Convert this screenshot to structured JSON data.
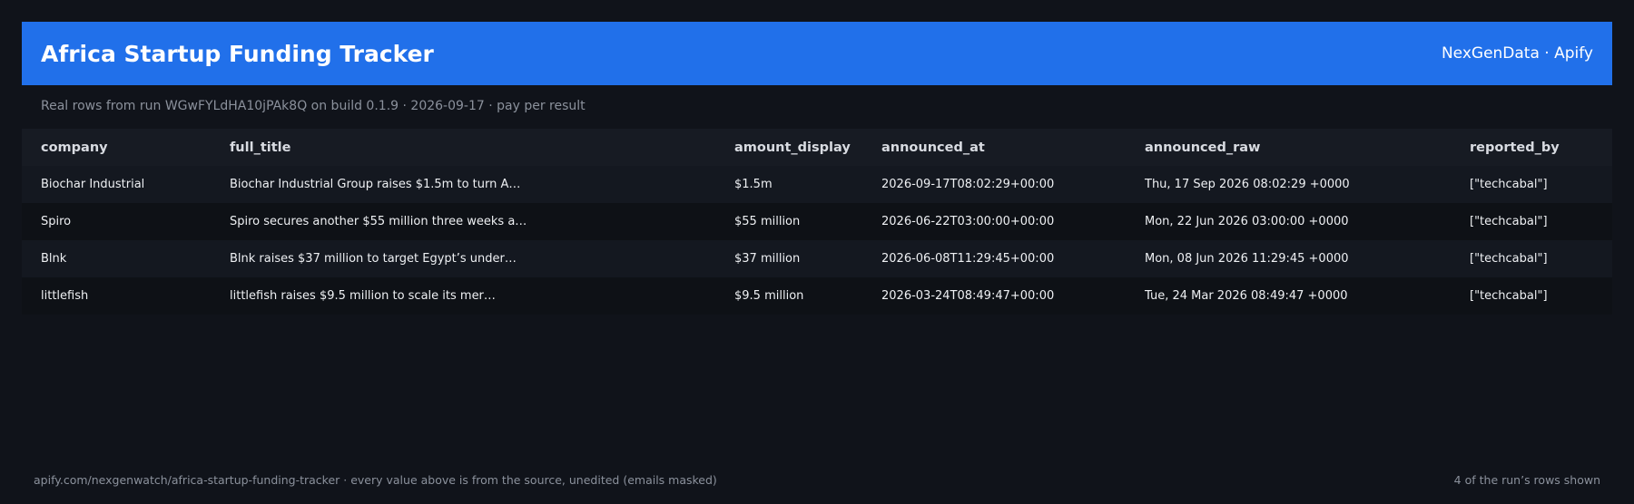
{
  "header": {
    "title": "Africa Startup Funding Tracker",
    "brand": "NexGenData · Apify"
  },
  "subtitle": "Real rows from run WGwFYLdHA10jPAk8Q on build 0.1.9 · 2026-09-17 · pay per result",
  "table": {
    "columns": [
      "company",
      "full_title",
      "amount_display",
      "announced_at",
      "announced_raw",
      "reported_by"
    ],
    "rows": [
      [
        "Biochar Industrial",
        "Biochar Industrial Group raises $1.5m to turn A…",
        "$1.5m",
        "2026-09-17T08:02:29+00:00",
        "Thu, 17 Sep 2026 08:02:29 +0000",
        "[\"techcabal\"]"
      ],
      [
        "Spiro",
        "Spiro secures another $55 million three weeks a…",
        "$55 million",
        "2026-06-22T03:00:00+00:00",
        "Mon, 22 Jun 2026 03:00:00 +0000",
        "[\"techcabal\"]"
      ],
      [
        "Blnk",
        "Blnk raises $37 million to target Egypt’s under…",
        "$37 million",
        "2026-06-08T11:29:45+00:00",
        "Mon, 08 Jun 2026 11:29:45 +0000",
        "[\"techcabal\"]"
      ],
      [
        "littlefish",
        "littlefish raises $9.5 million to scale its mer…",
        "$9.5 million",
        "2026-03-24T08:49:47+00:00",
        "Tue, 24 Mar 2026 08:49:47 +0000",
        "[\"techcabal\"]"
      ]
    ]
  },
  "footer": {
    "left": "apify.com/nexgenwatch/africa-startup-funding-tracker  ·  every value above is from the source, unedited (emails masked)",
    "right": "4 of the run’s rows shown"
  },
  "colors": {
    "background": "#10131a",
    "header_bg": "#2170ea",
    "muted_text": "#8b919c"
  }
}
